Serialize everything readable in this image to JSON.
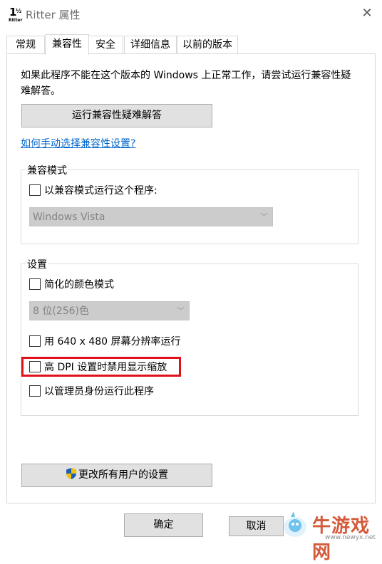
{
  "window": {
    "title": "Ritter 属性"
  },
  "tabs": [
    {
      "label": "常规"
    },
    {
      "label": "兼容性",
      "active": true
    },
    {
      "label": "安全"
    },
    {
      "label": "详细信息"
    },
    {
      "label": "以前的版本"
    }
  ],
  "compat": {
    "description": "如果此程序不能在这个版本的 Windows 上正常工作，请尝试运行兼容性疑难解答。",
    "troubleshoot_label": "运行兼容性疑难解答",
    "help_link": "如何手动选择兼容性设置?",
    "mode_group_title": "兼容模式",
    "mode_checkbox_label": "以兼容模式运行这个程序:",
    "mode_select_value": "Windows Vista"
  },
  "settings": {
    "group_title": "设置",
    "reduced_color_label": "简化的颜色模式",
    "color_select_value": "8 位(256)色",
    "res_640_label": "用 640 x 480 屏幕分辨率运行",
    "dpi_label": "高 DPI 设置时禁用显示缩放",
    "admin_label": "以管理员身份运行此程序"
  },
  "buttons": {
    "all_users_label": "更改所有用户的设置",
    "ok_label": "确定",
    "cancel_label": "取消"
  },
  "watermark": {
    "text": "牛游戏网",
    "url": "www.newyx.net"
  },
  "colors": {
    "highlight": "#e0111a",
    "link": "#0066cc"
  }
}
